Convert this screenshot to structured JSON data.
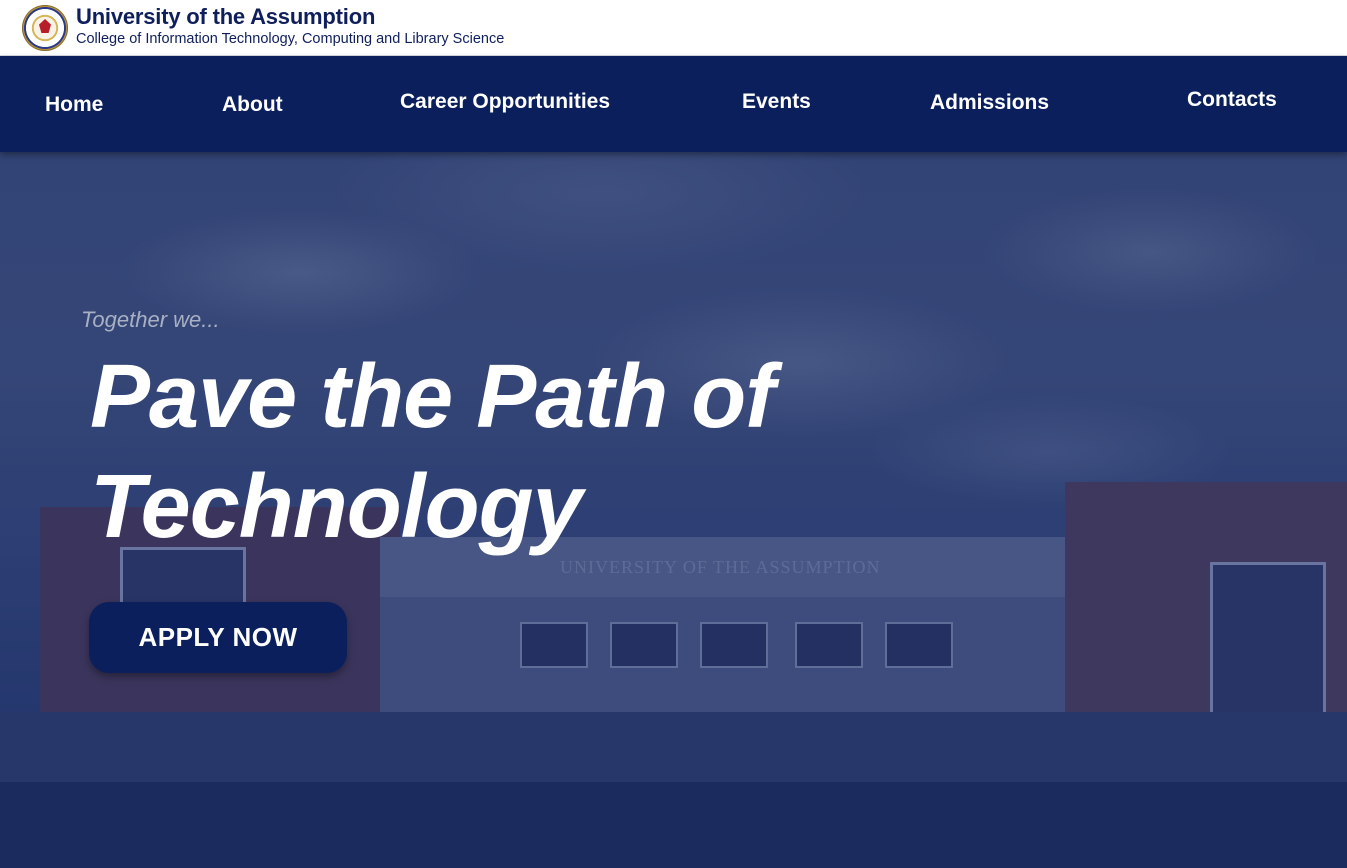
{
  "header": {
    "university": "University of the Assumption",
    "college": "College of Information Technology, Computing and Library Science",
    "logo_icon": "university-seal-icon"
  },
  "nav": {
    "items": [
      {
        "label": "Home"
      },
      {
        "label": "About"
      },
      {
        "label": "Career Opportunities"
      },
      {
        "label": "Events"
      },
      {
        "label": "Admissions"
      },
      {
        "label": "Contacts"
      }
    ]
  },
  "hero": {
    "tagline": "Together we...",
    "headline": "Pave the Path of Technology",
    "building_sign": "UNIVERSITY OF THE ASSUMPTION",
    "cta_label": "APPLY NOW"
  },
  "colors": {
    "navy": "#0a1f5c",
    "header_bg": "#ffffff",
    "text_white": "#ffffff",
    "tagline": "#a9b0c4"
  }
}
